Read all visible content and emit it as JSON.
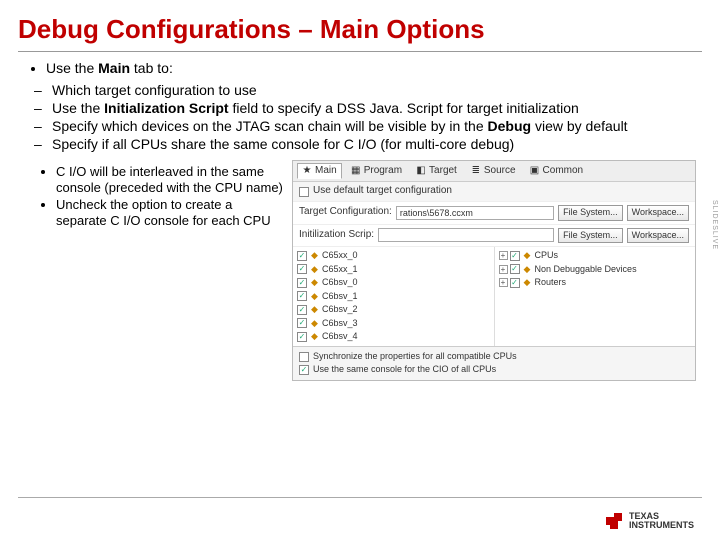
{
  "title": "Debug Configurations – Main Options",
  "bullet_main": "Use the <b>Main</b> tab to:",
  "bullets2": [
    "Which target configuration to use",
    "Use the <b>Initialization Script</b> field to specify a DSS Java. Script for target initialization",
    "Specify which devices on the JTAG scan chain will be visible by in the <b>Debug</b> view by default",
    "Specify if all CPUs share the same console for C I/O (for multi-core debug)"
  ],
  "bullets3": [
    "C I/O will be interleaved in the same console (preceded with the CPU name)",
    "Uncheck the option to create a separate C I/O console for each CPU"
  ],
  "screenshot": {
    "tabs": [
      {
        "icon": "★",
        "label": "Main"
      },
      {
        "icon": "▦",
        "label": "Program"
      },
      {
        "icon": "◧",
        "label": "Target"
      },
      {
        "icon": "≣",
        "label": "Source"
      },
      {
        "icon": "▣",
        "label": "Common"
      }
    ],
    "use_default_label": "Use default target configuration",
    "rows": [
      {
        "label": "Target Configuration:",
        "value": "rations\\5678.ccxm",
        "buttons": [
          "File System...",
          "Workspace..."
        ]
      },
      {
        "label": "Initilization Scrip:",
        "value": "",
        "buttons": [
          "File System...",
          "Workspace..."
        ]
      }
    ],
    "tree_left": [
      "C65xx_0",
      "C65xx_1",
      "C6bsv_0",
      "C6bsv_1",
      "C6bsv_2",
      "C6bsv_3",
      "C6bsv_4"
    ],
    "tree_right": [
      {
        "icon": "◆",
        "label": "CPUs",
        "expand": "+"
      },
      {
        "icon": "◆",
        "label": "Non Debuggable Devices",
        "expand": "+"
      },
      {
        "icon": "◆",
        "label": "Routers",
        "expand": "+"
      }
    ],
    "bottom_checks": [
      {
        "checked": false,
        "label": "Synchronize the properties for all compatible CPUs"
      },
      {
        "checked": true,
        "label": "Use the same console for the CIO of all CPUs"
      }
    ]
  },
  "logo_text": "TEXAS\nINSTRUMENTS",
  "watermark": "SLIDESLIVE"
}
